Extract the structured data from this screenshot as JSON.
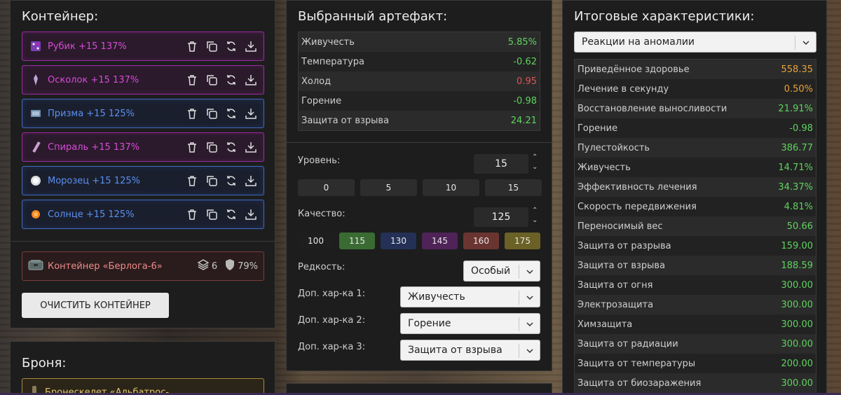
{
  "container": {
    "title": "Контейнер:",
    "artifacts": [
      {
        "label": "Рубик +15 137%",
        "tone": "mag",
        "icon": "cube-icon",
        "icon_color": "#7a3fb3"
      },
      {
        "label": "Осколок +15 137%",
        "tone": "mag",
        "icon": "shard-icon",
        "icon_color": "#b7a7d9"
      },
      {
        "label": "Призма +15 125%",
        "tone": "blu",
        "icon": "prism-icon",
        "icon_color": "#6e8faa"
      },
      {
        "label": "Спираль +15 137%",
        "tone": "mag",
        "icon": "spiral-icon",
        "icon_color": "#c9a0d0"
      },
      {
        "label": "Морозец +15 125%",
        "tone": "blu",
        "icon": "frost-icon",
        "icon_color": "#ffffff"
      },
      {
        "label": "Солнце +15 125%",
        "tone": "blu",
        "icon": "sun-icon",
        "icon_color": "#f08a24"
      }
    ],
    "container_item": {
      "label": "Контейнер «Берлога-6»",
      "slots": "6",
      "protection": "79%"
    },
    "clear_button": "ОЧИСТИТЬ КОНТЕЙНЕР"
  },
  "armor": {
    "title": "Броня:",
    "item_label": "Бронескелет «Альбатрос-"
  },
  "selected": {
    "title": "Выбранный артефакт:",
    "stats": [
      {
        "name": "Живучесть",
        "value": "5.85%",
        "color": "#5fd35f"
      },
      {
        "name": "Температура",
        "value": "-0.62",
        "color": "#5fd35f"
      },
      {
        "name": "Холод",
        "value": "0.95",
        "color": "#e05454"
      },
      {
        "name": "Горение",
        "value": "-0.98",
        "color": "#5fd35f"
      },
      {
        "name": "Защита от взрыва",
        "value": "24.21",
        "color": "#5fd35f"
      }
    ],
    "level_label": "Уровень:",
    "level_value": "15",
    "level_presets": [
      "0",
      "5",
      "10",
      "15"
    ],
    "quality_label": "Качество:",
    "quality_value": "125",
    "quality_presets": [
      {
        "label": "100",
        "color": "#1e1e1e"
      },
      {
        "label": "115",
        "color": "#3a6b33"
      },
      {
        "label": "130",
        "color": "#243056"
      },
      {
        "label": "145",
        "color": "#4f2357"
      },
      {
        "label": "160",
        "color": "#6a3531"
      },
      {
        "label": "175",
        "color": "#6b6126"
      }
    ],
    "rarity_label": "Редкость:",
    "rarity_value": "Особый",
    "extra1_label": "Доп. хар-ка 1:",
    "extra1_value": "Живучесть",
    "extra2_label": "Доп. хар-ка 2:",
    "extra2_value": "Горение",
    "extra3_label": "Доп. хар-ка 3:",
    "extra3_value": "Защита от взрыва"
  },
  "totals": {
    "title": "Итоговые характеристики:",
    "reaction_value": "Реакции на аномалии",
    "stats": [
      {
        "name": "Приведённое здоровье",
        "value": "558.35",
        "color": "#e8a23a"
      },
      {
        "name": "Лечение в секунду",
        "value": "0.50%",
        "color": "#e8a23a"
      },
      {
        "name": "Восстановление выносливости",
        "value": "21.91%",
        "color": "#5fd35f"
      },
      {
        "name": "Горение",
        "value": "-0.98",
        "color": "#5fd35f"
      },
      {
        "name": "Пулестойкость",
        "value": "386.77",
        "color": "#5fd35f"
      },
      {
        "name": "Живучесть",
        "value": "14.71%",
        "color": "#5fd35f"
      },
      {
        "name": "Эффективность лечения",
        "value": "34.37%",
        "color": "#5fd35f"
      },
      {
        "name": "Скорость передвижения",
        "value": "4.81%",
        "color": "#5fd35f"
      },
      {
        "name": "Переносимый вес",
        "value": "50.66",
        "color": "#5fd35f"
      },
      {
        "name": "Защита от разрыва",
        "value": "159.00",
        "color": "#5fd35f"
      },
      {
        "name": "Защита от взрыва",
        "value": "188.59",
        "color": "#5fd35f"
      },
      {
        "name": "Защита от огня",
        "value": "300.00",
        "color": "#5fd35f"
      },
      {
        "name": "Электрозащита",
        "value": "300.00",
        "color": "#5fd35f"
      },
      {
        "name": "Химзащита",
        "value": "300.00",
        "color": "#5fd35f"
      },
      {
        "name": "Защита от радиации",
        "value": "300.00",
        "color": "#5fd35f"
      },
      {
        "name": "Защита от температуры",
        "value": "200.00",
        "color": "#5fd35f"
      },
      {
        "name": "Защита от биозаражения",
        "value": "300.00",
        "color": "#5fd35f"
      }
    ]
  }
}
